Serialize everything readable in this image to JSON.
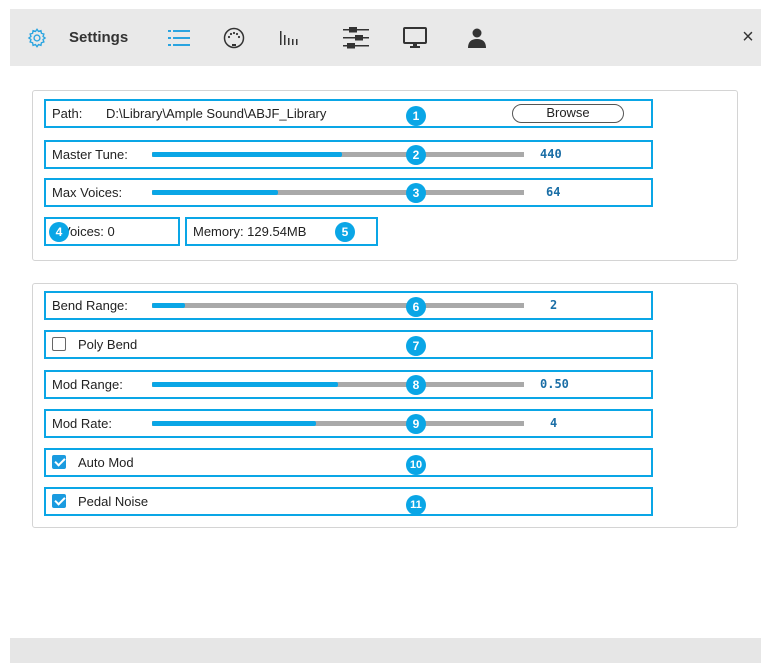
{
  "toolbar": {
    "title": "Settings",
    "icons": [
      "gear-icon",
      "list-icon",
      "midi-connector-icon",
      "bars-icon",
      "mixer-sliders-icon",
      "monitor-icon",
      "user-icon"
    ],
    "close": "×"
  },
  "general": {
    "path_label": "Path:",
    "path_value": "D:\\Library\\Ample Sound\\ABJF_Library",
    "browse_label": "Browse",
    "master_tune_label": "Master Tune:",
    "master_tune_value": "440",
    "master_tune_level": 0.51,
    "max_voices_label": "Max Voices:",
    "max_voices_value": "64",
    "max_voices_level": 0.34,
    "voices_label": "Voices: 0",
    "memory_label": "Memory:  129.54MB"
  },
  "performance": {
    "bend_range_label": "Bend Range:",
    "bend_range_value": "2",
    "bend_range_level": 0.09,
    "poly_bend_label": "Poly Bend",
    "poly_bend_checked": false,
    "mod_range_label": "Mod Range:",
    "mod_range_value": "0.50",
    "mod_range_level": 0.5,
    "mod_rate_label": "Mod Rate:",
    "mod_rate_value": "4",
    "mod_rate_level": 0.44,
    "auto_mod_label": "Auto Mod",
    "auto_mod_checked": true,
    "pedal_noise_label": "Pedal Noise",
    "pedal_noise_checked": true
  },
  "badges": [
    "1",
    "2",
    "3",
    "4",
    "5",
    "6",
    "7",
    "8",
    "9",
    "10",
    "11"
  ],
  "colors": {
    "accent": "#0aa6e6",
    "track": "#a9a9a9",
    "value_text": "#1a6ea6"
  }
}
